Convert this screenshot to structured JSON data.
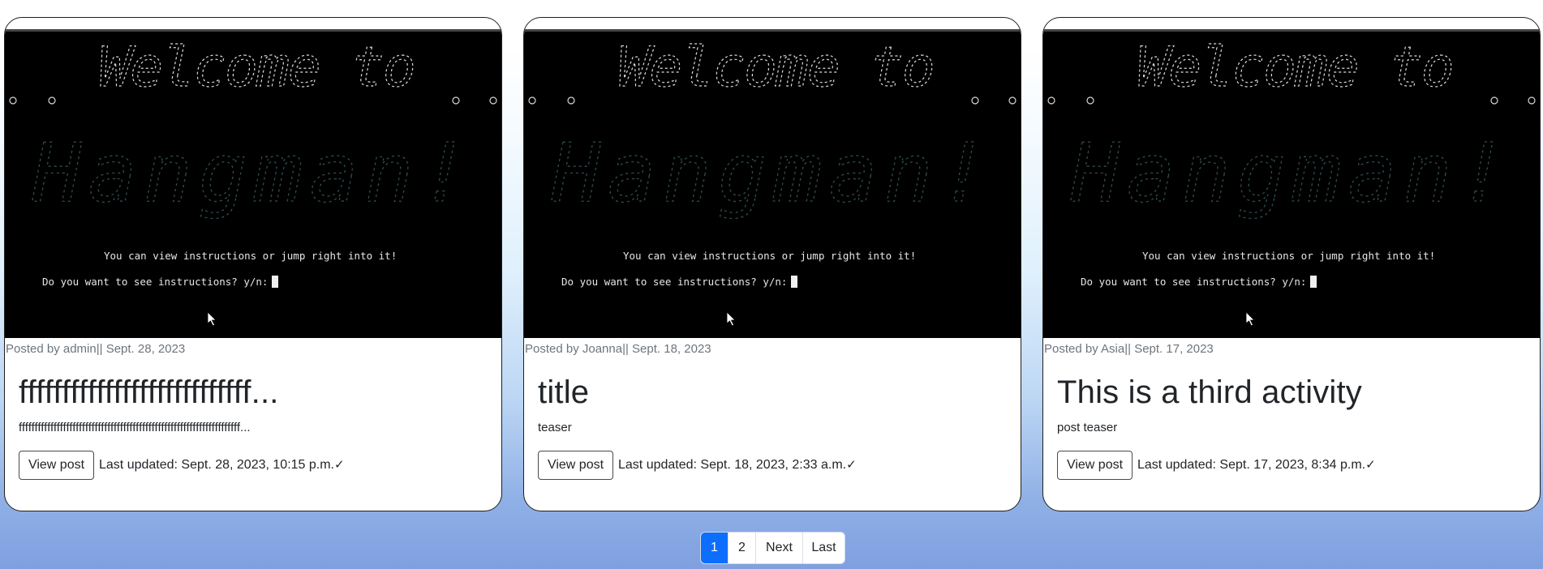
{
  "posts": [
    {
      "image": {
        "banner_top": "Welcome to",
        "banner_main": "Hangman!",
        "line1": "You can view instructions or jump right into it!",
        "line2": "Do you want to see instructions? y/n:"
      },
      "meta": "Posted by admin|| Sept. 28, 2023",
      "title": "fffffffffffffffffffffffffff...",
      "teaser": "ffffffffffffffffffffffffffffffffffffffffffffffffffffffffffffffffffffff...",
      "button_label": "View post",
      "updated": "Last updated: Sept. 28, 2023, 10:15 p.m.",
      "check": "✓"
    },
    {
      "image": {
        "banner_top": "Welcome to",
        "banner_main": "Hangman!",
        "line1": "You can view instructions or jump right into it!",
        "line2": "Do you want to see instructions? y/n:"
      },
      "meta": "Posted by Joanna|| Sept. 18, 2023",
      "title": "title",
      "teaser": "teaser",
      "button_label": "View post",
      "updated": "Last updated: Sept. 18, 2023, 2:33 a.m.",
      "check": "✓"
    },
    {
      "image": {
        "banner_top": "Welcome to",
        "banner_main": "Hangman!",
        "line1": "You can view instructions or jump right into it!",
        "line2": "Do you want to see instructions? y/n:"
      },
      "meta": "Posted by Asia|| Sept. 17, 2023",
      "title": "This is a third activity",
      "teaser": "post teaser",
      "button_label": "View post",
      "updated": "Last updated: Sept. 17, 2023, 8:34 p.m.",
      "check": "✓"
    }
  ],
  "pagination": {
    "pages": [
      "1",
      "2"
    ],
    "active_page": "1",
    "next_label": "Next",
    "last_label": "Last"
  },
  "colors": {
    "active_page": "#0d6efd",
    "meta_text": "#6c757d",
    "banner_top": "#d8d8d8",
    "banner_main": "#2f4f4f"
  }
}
